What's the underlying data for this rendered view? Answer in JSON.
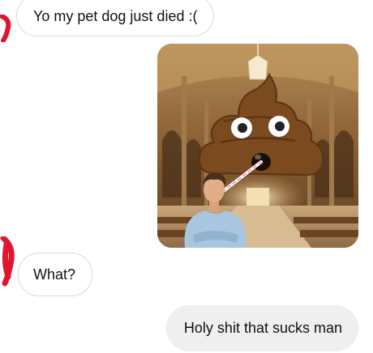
{
  "thread": {
    "messages": [
      {
        "sender": "other",
        "kind": "text",
        "text": "Yo my pet dog just died :("
      },
      {
        "sender": "other",
        "kind": "image",
        "icon": "poop-emoji-church-meme-image"
      },
      {
        "sender": "other",
        "kind": "text",
        "text": "What?"
      },
      {
        "sender": "self",
        "kind": "text",
        "text": "Holy shit that sucks man"
      }
    ]
  },
  "colors": {
    "incoming_bubble": "#ffffff",
    "incoming_border": "#d9d9d9",
    "outgoing_bubble": "#efefef",
    "text": "#111111",
    "red_marks": "#e01530",
    "poop": "#7b4a1f"
  }
}
